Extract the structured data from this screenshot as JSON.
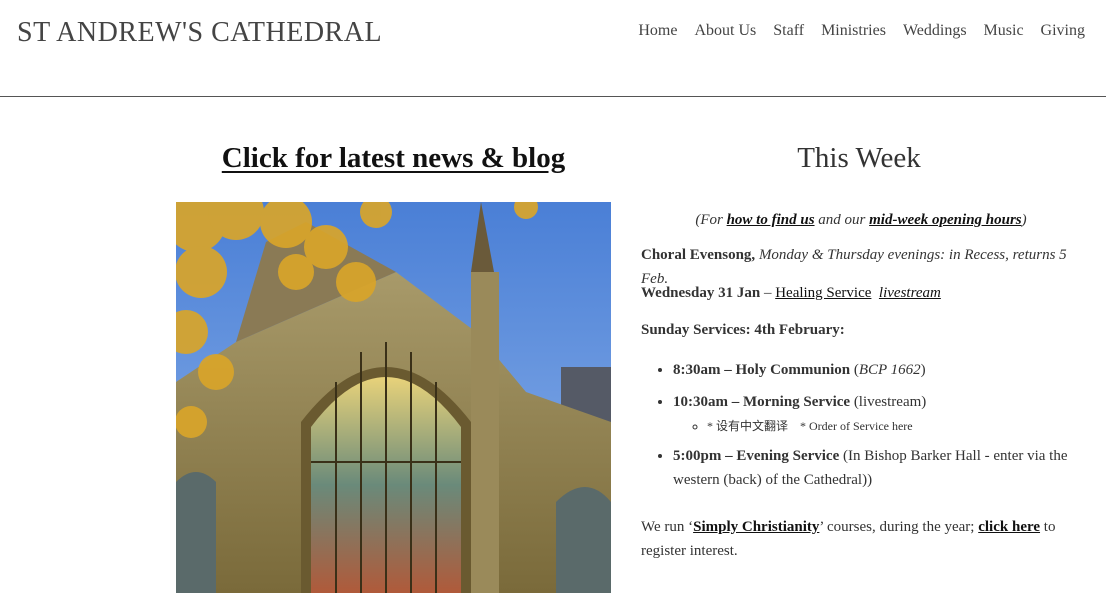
{
  "site": {
    "title": "ST ANDREW'S CATHEDRAL"
  },
  "nav": [
    "Home",
    "About Us",
    "Staff",
    "Ministries",
    "Weddings",
    "Music",
    "Giving"
  ],
  "news": {
    "link": "Click for latest news & blog"
  },
  "week": {
    "title": "This Week",
    "find_pre": "(For ",
    "find_link": "how to find us",
    "find_mid": " and our ",
    "hours_link": "mid-week opening hours",
    "find_post": ")",
    "evensong_label": "Choral Evensong,",
    "evensong_text": " Monday & Thursday evenings: in Recess, returns 5 Feb.",
    "wed_label": "Wednesday 31 Jan",
    "wed_dash": " – ",
    "healing_link": "Healing Service",
    "livestream_link": "livestream",
    "sunday_label": "Sunday Services: 4th February:",
    "services": {
      "s1_label": "8:30am – Holy Communion",
      "s1_pre": " (",
      "s1_note": "BCP 1662",
      "s1_post": ")",
      "s2_label": "10:30am – Morning Service",
      "s2_note": " (livestream)",
      "s2_sub1": "* 设有中文翻译",
      "s2_sub2": "* Order of Service here",
      "s3_label": "5:00pm – Evening Service",
      "s3_note": " (In Bishop Barker Hall - enter via the western (back) of the Cathedral))"
    },
    "simply_pre": "We run ‘",
    "simply_link": "Simply Christianity",
    "simply_mid": "’ courses, during the year; ",
    "click_link": "click here",
    "simply_post": " to register interest."
  }
}
